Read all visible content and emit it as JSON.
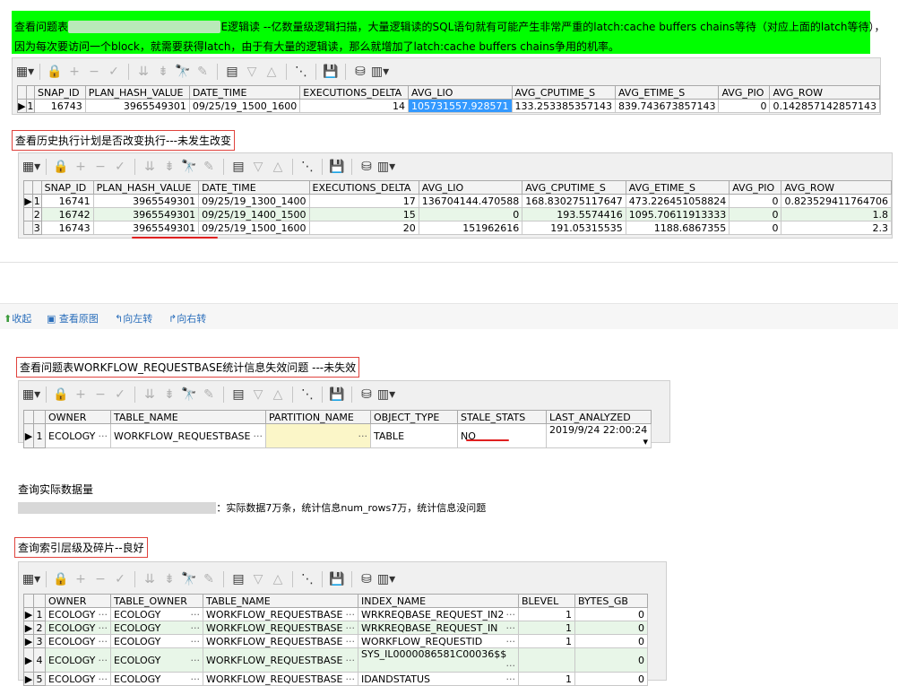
{
  "top_banner": {
    "line1_start": "查看问题表",
    "line1_end": "E逻辑读 --亿数量级逻辑扫描，大量逻辑读的SQL语句就有可能产生非常严重的latch:cache buffers chains等待（对应上面的latch等待），",
    "line2": "因为每次要访问一个block，就需要获得latch，由于有大量的逻辑读，那么就增加了latch:cache buffers chains争用的机率。"
  },
  "grid1": {
    "columns": [
      "SNAP_ID",
      "PLAN_HASH_VALUE",
      "DATE_TIME",
      "EXECUTIONS_DELTA",
      "AVG_LIO",
      "AVG_CPUTIME_S",
      "AVG_ETIME_S",
      "AVG_PIO",
      "AVG_ROW"
    ],
    "rows": [
      {
        "rn": "1",
        "cells": [
          "16743",
          "3965549301",
          "09/25/19_1500_1600",
          "14",
          "105731557.928571",
          "133.253385357143",
          "839.743673857143",
          "0",
          "0.142857142857143"
        ]
      }
    ]
  },
  "section2_title": "查看历史执行计划是否改变执行---未发生改变",
  "grid2": {
    "columns": [
      "SNAP_ID",
      "PLAN_HASH_VALUE",
      "DATE_TIME",
      "EXECUTIONS_DELTA",
      "AVG_LIO",
      "AVG_CPUTIME_S",
      "AVG_ETIME_S",
      "AVG_PIO",
      "AVG_ROW"
    ],
    "rows": [
      {
        "rn": "1",
        "cells": [
          "16741",
          "3965549301",
          "09/25/19_1300_1400",
          "17",
          "136704144.470588",
          "168.830275117647",
          "473.226451058824",
          "0",
          "0.823529411764706"
        ]
      },
      {
        "rn": "2",
        "cells": [
          "16742",
          "3965549301",
          "09/25/19_1400_1500",
          "15",
          "0",
          "193.5574416",
          "1095.70611913333",
          "0",
          "1.8"
        ]
      },
      {
        "rn": "3",
        "cells": [
          "16743",
          "3965549301",
          "09/25/19_1500_1600",
          "20",
          "151962616",
          "191.05315535",
          "1188.6867355",
          "0",
          "2.3"
        ]
      }
    ]
  },
  "nav": {
    "collapse": "收起",
    "view_original": "查看原图",
    "rotate_left": "向左转",
    "rotate_right": "向右转"
  },
  "section3_title": "查看问题表WORKFLOW_REQUESTBASE统计信息失效问题 ---未失效",
  "grid3": {
    "columns": [
      "OWNER",
      "TABLE_NAME",
      "PARTITION_NAME",
      "OBJECT_TYPE",
      "STALE_STATS",
      "LAST_ANALYZED"
    ],
    "rows": [
      {
        "rn": "1",
        "cells": [
          "ECOLOGY",
          "WORKFLOW_REQUESTBASE",
          "",
          "TABLE",
          "NO",
          "2019/9/24 22:00:24"
        ]
      }
    ]
  },
  "section4_title": "查询实际数据量",
  "section4_text": "：实际数据7万条，统计信息num_rows7万，统计信息没问题",
  "section5_title": "查询索引层级及碎片--良好",
  "grid4": {
    "columns": [
      "OWNER",
      "TABLE_OWNER",
      "TABLE_NAME",
      "INDEX_NAME",
      "BLEVEL",
      "BYTES_GB"
    ],
    "rows": [
      {
        "rn": "1",
        "cells": [
          "ECOLOGY",
          "ECOLOGY",
          "WORKFLOW_REQUESTBASE",
          "WRKREQBASE_REQUEST_IN2",
          "1",
          "0"
        ]
      },
      {
        "rn": "2",
        "cells": [
          "ECOLOGY",
          "ECOLOGY",
          "WORKFLOW_REQUESTBASE",
          "WRKREQBASE_REQUEST_IN",
          "1",
          "0"
        ]
      },
      {
        "rn": "3",
        "cells": [
          "ECOLOGY",
          "ECOLOGY",
          "WORKFLOW_REQUESTBASE",
          "WORKFLOW_REQUESTID",
          "1",
          "0"
        ]
      },
      {
        "rn": "4",
        "cells": [
          "ECOLOGY",
          "ECOLOGY",
          "WORKFLOW_REQUESTBASE",
          "SYS_IL0000086581C00036$$",
          "",
          "0"
        ]
      },
      {
        "rn": "5",
        "cells": [
          "ECOLOGY",
          "ECOLOGY",
          "WORKFLOW_REQUESTBASE",
          "IDANDSTATUS",
          "1",
          "0"
        ]
      }
    ]
  },
  "icons": [
    "grid-menu-icon",
    "lock-icon",
    "plus-icon",
    "minus-icon",
    "check-icon",
    "filter-down-icon",
    "filter-clear-icon",
    "binoculars-icon",
    "eraser-icon",
    "grid-export-icon",
    "triangle-down-icon",
    "triangle-up-icon",
    "tree-icon",
    "save-icon",
    "database-icon",
    "chart-icon"
  ],
  "colors": {
    "highlight": "#00ff00",
    "alt_row": "#e8f6e8",
    "selected": "#3399ff",
    "red": "#e0433d",
    "nav_link": "#2a6ebb"
  }
}
